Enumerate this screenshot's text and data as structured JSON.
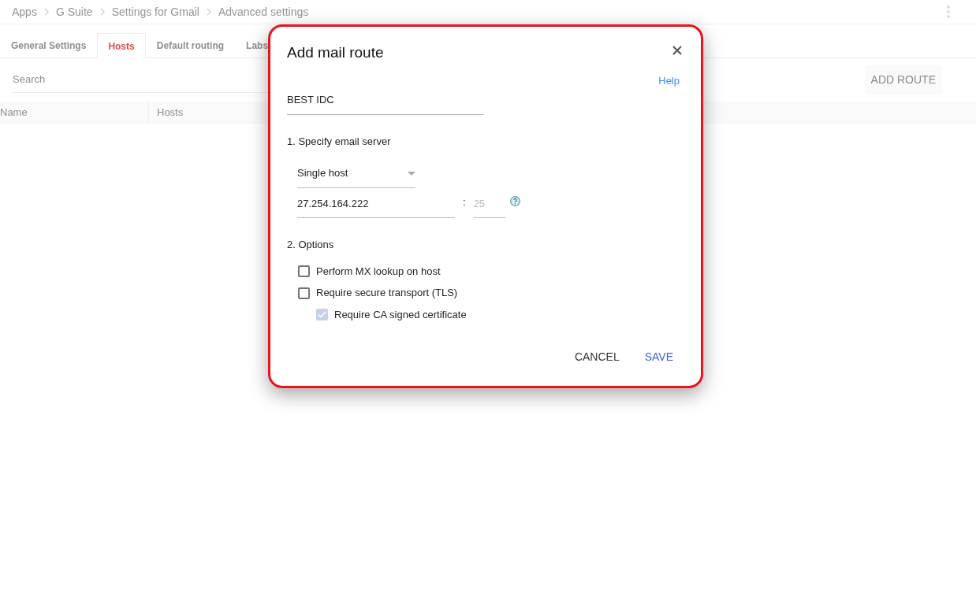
{
  "breadcrumb": [
    "Apps",
    "G Suite",
    "Settings for Gmail",
    "Advanced settings"
  ],
  "tabs": [
    {
      "label": "General Settings",
      "selected": false
    },
    {
      "label": "Hosts",
      "selected": true
    },
    {
      "label": "Default routing",
      "selected": false
    },
    {
      "label": "Labs",
      "selected": false
    }
  ],
  "search": {
    "placeholder": "Search"
  },
  "add_button": "ADD ROUTE",
  "table": {
    "columns": [
      "Name",
      "Hosts"
    ]
  },
  "dialog": {
    "title": "Add mail route",
    "help": "Help",
    "name_value": "BEST IDC",
    "section_1": "1. Specify email server",
    "server_type": "Single host",
    "host_value": "27.254.164.222",
    "separator": ":",
    "port_placeholder": "25",
    "section_2": "2. Options",
    "options": [
      {
        "label": "Perform MX lookup on host",
        "checked": false,
        "disabled": false,
        "indented": false
      },
      {
        "label": "Require secure transport (TLS)",
        "checked": false,
        "disabled": false,
        "indented": false
      },
      {
        "label": "Require CA signed certificate",
        "checked": true,
        "disabled": true,
        "indented": true
      }
    ],
    "buttons": [
      {
        "label": "CANCEL",
        "kind": "secondary"
      },
      {
        "label": "SAVE",
        "kind": "primary"
      }
    ]
  }
}
